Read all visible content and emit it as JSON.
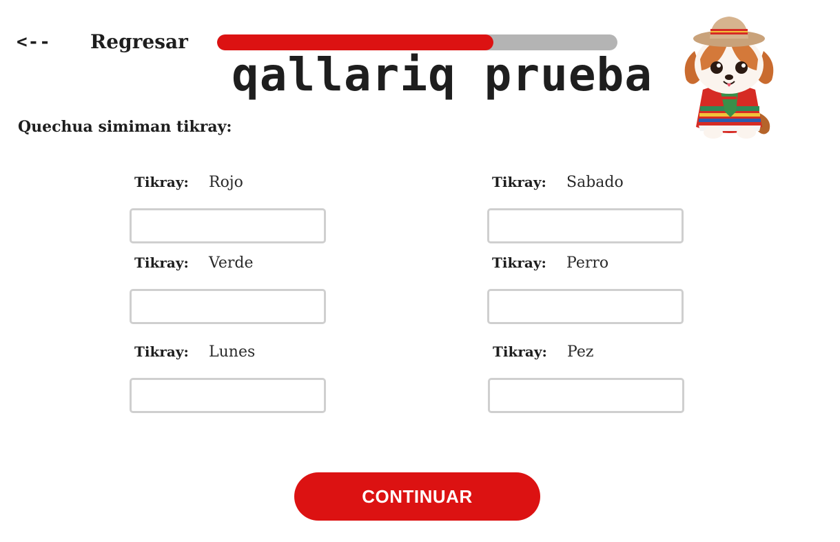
{
  "header": {
    "back_arrow": "<--",
    "back_label": "Regresar",
    "title": "qallariq prueba",
    "progress": 0.69,
    "progress_color": "#dc1212",
    "progress_track_color": "#b4b4b4"
  },
  "mascot": {
    "icon": "puppy-mascot-with-hat-and-poncho-icon"
  },
  "instruction": "Quechua simiman tikray:",
  "items": [
    {
      "label": "Tikray:",
      "word": "Rojo",
      "value": "",
      "placeholder": ""
    },
    {
      "label": "Tikray:",
      "word": "Sabado",
      "value": "",
      "placeholder": ""
    },
    {
      "label": "Tikray:",
      "word": "Verde",
      "value": "",
      "placeholder": ""
    },
    {
      "label": "Tikray:",
      "word": "Perro",
      "value": "",
      "placeholder": ""
    },
    {
      "label": "Tikray:",
      "word": "Lunes",
      "value": "",
      "placeholder": ""
    },
    {
      "label": "Tikray:",
      "word": "Pez",
      "value": "",
      "placeholder": ""
    }
  ],
  "continue_label": "CONTINUAR",
  "colors": {
    "accent": "#dc1212",
    "text": "#1e1e1e",
    "input_border": "#cfcfcf"
  }
}
